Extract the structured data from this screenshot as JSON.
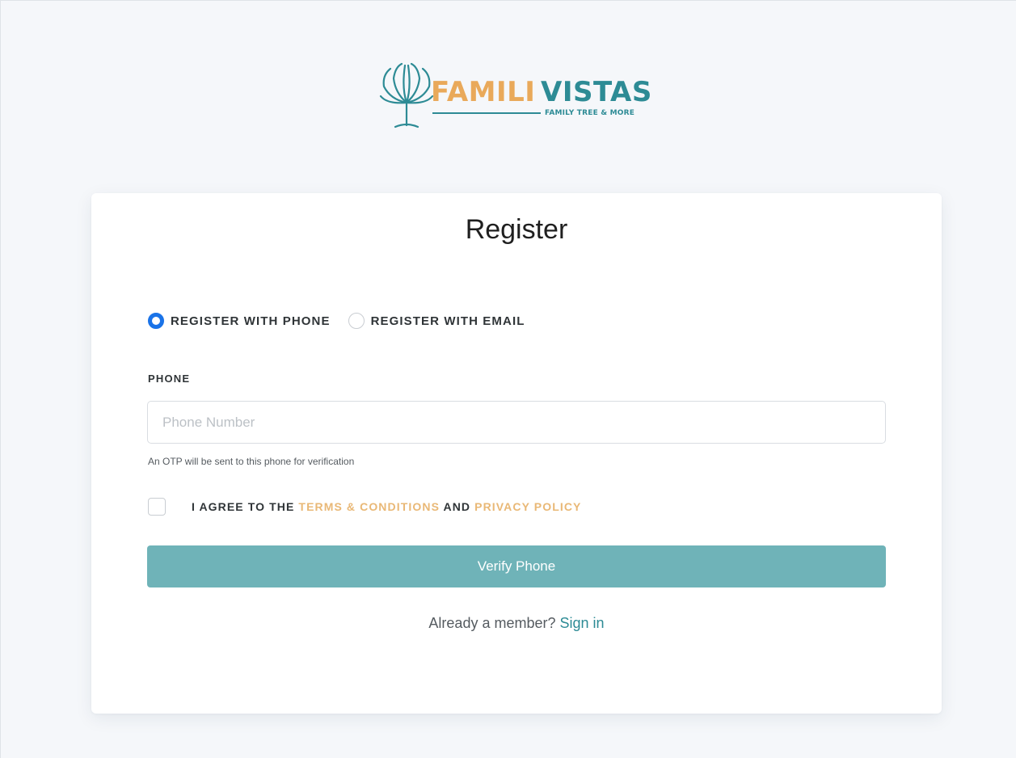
{
  "brand": {
    "name_part1": "FAMILI",
    "name_part2": "VISTAS",
    "tagline": "FAMILY TREE & MORE",
    "primary_color": "#2d8b95",
    "accent_color": "#e9a95a"
  },
  "form": {
    "title": "Register",
    "registration_method": {
      "options": [
        {
          "label": "REGISTER WITH PHONE",
          "checked": true
        },
        {
          "label": "REGISTER WITH EMAIL",
          "checked": false
        }
      ]
    },
    "phone": {
      "label": "PHONE",
      "value": "",
      "placeholder": "Phone Number",
      "help_text": "An OTP will be sent to this phone for verification"
    },
    "agreement": {
      "checked": false,
      "prefix": "I AGREE TO THE",
      "terms_link": "TERMS & CONDITIONS",
      "conjunction": "AND",
      "privacy_link": "PRIVACY POLICY"
    },
    "submit_label": "Verify Phone",
    "submit_color": "#6fb3b8",
    "signin_prompt": "Already a member?",
    "signin_link": "Sign in"
  }
}
